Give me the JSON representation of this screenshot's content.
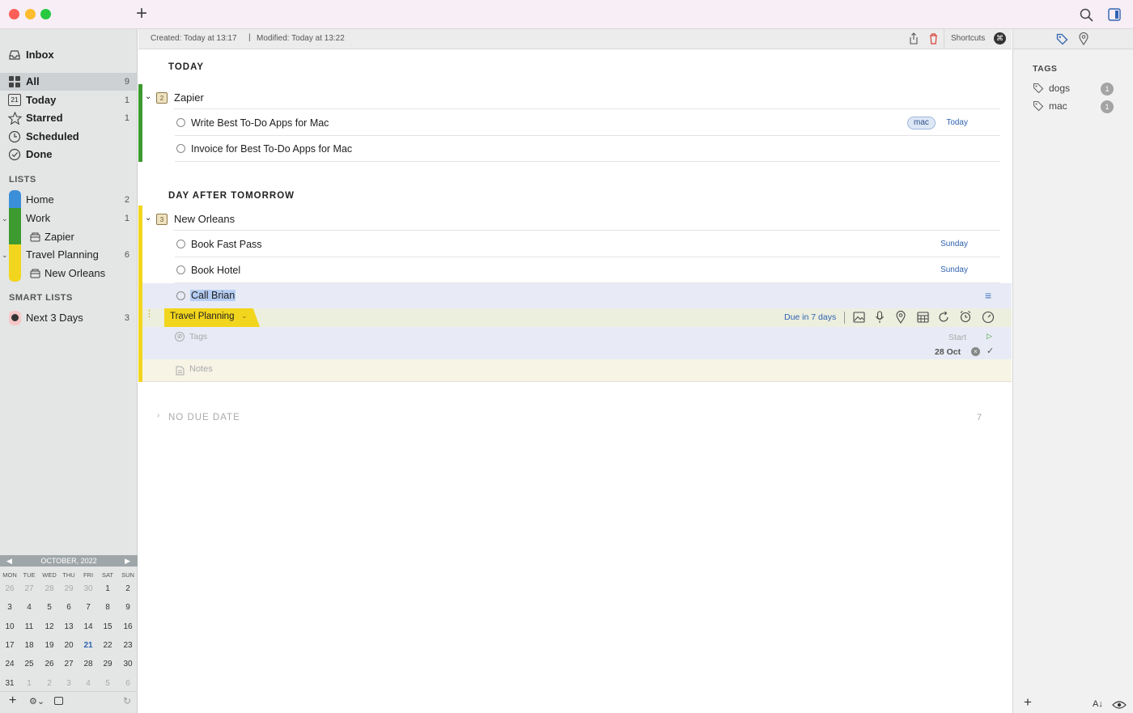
{
  "titlebar": {
    "add": "+"
  },
  "infobar": {
    "created": "Created: Today at 13:17",
    "separator": "|",
    "modified": "Modified: Today at 13:22",
    "shortcuts": "Shortcuts",
    "shortcuts_key": "⌘"
  },
  "sidebar": {
    "items": [
      {
        "label": "Inbox",
        "count": ""
      },
      {
        "label": "All",
        "count": "9"
      },
      {
        "label": "Today",
        "count": "1",
        "icon_text": "21"
      },
      {
        "label": "Starred",
        "count": "1"
      },
      {
        "label": "Scheduled",
        "count": ""
      },
      {
        "label": "Done",
        "count": ""
      }
    ],
    "lists_header": "LISTS",
    "lists": [
      {
        "label": "Home",
        "count": "2",
        "color": "#3b8fd9"
      },
      {
        "label": "Work",
        "count": "1",
        "color": "#3c9a2e"
      },
      {
        "label": "Zapier",
        "count": ""
      },
      {
        "label": "Travel Planning",
        "count": "6",
        "color": "#f2d51d"
      },
      {
        "label": "New Orleans",
        "count": ""
      }
    ],
    "smart_header": "SMART LISTS",
    "smart": [
      {
        "label": "Next 3 Days",
        "count": "3"
      }
    ]
  },
  "calendar": {
    "month": "OCTOBER, 2022",
    "days": [
      "MON",
      "TUE",
      "WED",
      "THU",
      "FRI",
      "SAT",
      "SUN"
    ],
    "weeks": [
      [
        "26",
        "27",
        "28",
        "29",
        "30",
        "1",
        "2"
      ],
      [
        "3",
        "4",
        "5",
        "6",
        "7",
        "8",
        "9"
      ],
      [
        "10",
        "11",
        "12",
        "13",
        "14",
        "15",
        "16"
      ],
      [
        "17",
        "18",
        "19",
        "20",
        "21",
        "22",
        "23"
      ],
      [
        "24",
        "25",
        "26",
        "27",
        "28",
        "29",
        "30"
      ],
      [
        "31",
        "1",
        "2",
        "3",
        "4",
        "5",
        "6"
      ]
    ]
  },
  "main": {
    "today_header": "TODAY",
    "zapier": {
      "name": "Zapier",
      "count": "2"
    },
    "zapier_tasks": [
      {
        "text": "Write Best To-Do Apps for Mac",
        "tag": "mac",
        "due": "Today"
      },
      {
        "text": "Invoice for Best To-Do Apps for Mac",
        "tag": "",
        "due": ""
      }
    ],
    "dat_header": "DAY AFTER TOMORROW",
    "nola": {
      "name": "New Orleans",
      "count": "3"
    },
    "nola_tasks": [
      {
        "text": "Book Fast Pass",
        "due": "Sunday"
      },
      {
        "text": "Book Hotel",
        "due": "Sunday"
      }
    ],
    "selected_task": {
      "text": "Call Brian"
    },
    "detail": {
      "list": "Travel Planning",
      "due": "Due in 7 days",
      "tags_placeholder": "Tags",
      "start_label": "Start",
      "start_date": "28 Oct",
      "notes_placeholder": "Notes"
    },
    "no_due": {
      "label": "NO DUE DATE",
      "count": "7"
    }
  },
  "rpanel": {
    "tags_header": "TAGS",
    "tags": [
      {
        "name": "dogs",
        "count": "1"
      },
      {
        "name": "mac",
        "count": "1"
      }
    ]
  },
  "colors": {
    "work_green": "#3c9a2e",
    "travel_yellow": "#f2d51d",
    "home_blue": "#3b8fd9",
    "link_blue": "#2f63b1"
  }
}
